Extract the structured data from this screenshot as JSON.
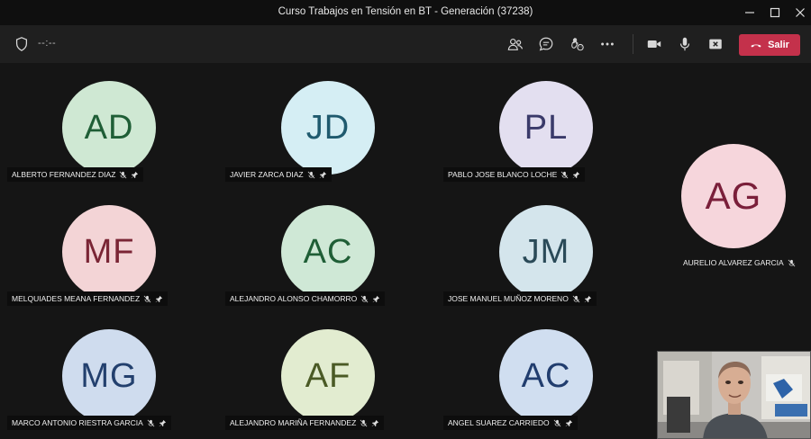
{
  "window": {
    "title": "Curso Trabajos en Tensión en BT - Generación (37238)"
  },
  "toolbar": {
    "timer": "--:--",
    "leave_label": "Salir",
    "leave_color": "#c4314b",
    "icons": [
      "shield-icon",
      "participants-icon",
      "chat-icon",
      "reactions-icon",
      "more-icon",
      "camera-icon",
      "microphone-icon",
      "share-icon"
    ]
  },
  "participants": [
    {
      "initials": "AD",
      "name": "ALBERTO FERNANDEZ DIAZ",
      "bg": "#cfe8d3",
      "fg": "#1f5e36"
    },
    {
      "initials": "JD",
      "name": "JAVIER ZARCA DIAZ",
      "bg": "#d5eef4",
      "fg": "#1f5a6e"
    },
    {
      "initials": "PL",
      "name": "PABLO JOSE BLANCO LOCHE",
      "bg": "#e3dff0",
      "fg": "#3a3a6a"
    },
    {
      "initials": "MF",
      "name": "MELQUIADES MEANA FERNANDEZ",
      "bg": "#f3d4d6",
      "fg": "#7a2535"
    },
    {
      "initials": "AC",
      "name": "ALEJANDRO ALONSO CHAMORRO",
      "bg": "#cfe8d6",
      "fg": "#1f5e36"
    },
    {
      "initials": "JM",
      "name": "JOSE MANUEL MUÑOZ MORENO",
      "bg": "#d4e5ec",
      "fg": "#2a4a58"
    },
    {
      "initials": "MG",
      "name": "MARCO ANTONIO RIESTRA GARCIA",
      "bg": "#cfdcee",
      "fg": "#23406e"
    },
    {
      "initials": "AF",
      "name": "ALEJANDRO MARIÑA FERNANDEZ",
      "bg": "#e2ecd0",
      "fg": "#4a5a25"
    },
    {
      "initials": "AC",
      "name": "ANGEL SUAREZ CARRIEDO",
      "bg": "#d0def0",
      "fg": "#213d6e"
    },
    {
      "initials": "AG",
      "name": "AURELIO ALVAREZ GARCIA",
      "bg": "#f6d6dc",
      "fg": "#7a1f3a"
    }
  ]
}
